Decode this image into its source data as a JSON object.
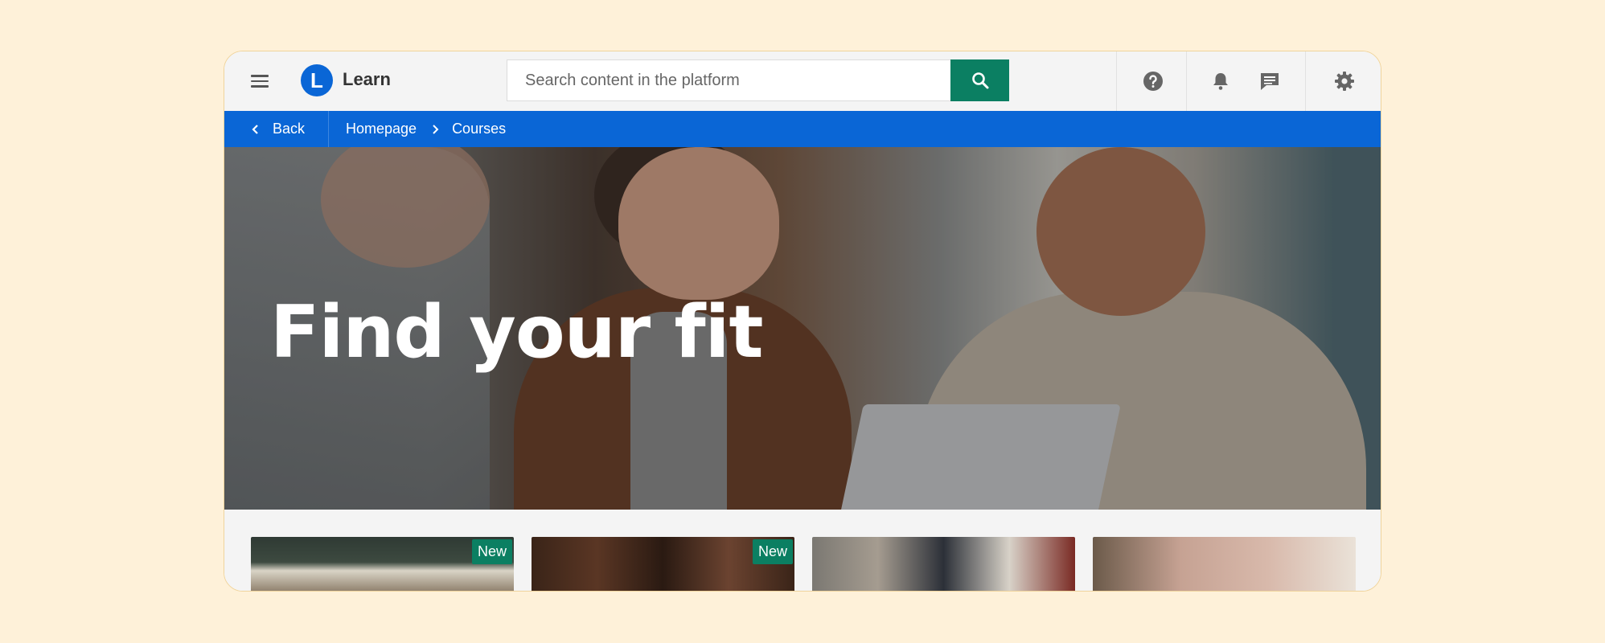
{
  "app": {
    "brand_logo_letter": "L",
    "brand_name": "Learn"
  },
  "search": {
    "placeholder": "Search content in the platform",
    "value": ""
  },
  "breadcrumb": {
    "back_label": "Back",
    "items": [
      "Homepage",
      "Courses"
    ]
  },
  "hero": {
    "title": "Find your fit"
  },
  "cards": [
    {
      "badge": "New"
    },
    {
      "badge": "New"
    },
    {
      "badge": ""
    },
    {
      "badge": ""
    }
  ],
  "colors": {
    "primary_blue": "#0a66d6",
    "search_green": "#0b7f62",
    "badge_green": "#0b7f62",
    "page_background": "#fef1d9"
  },
  "icons": {
    "menu": "hamburger-icon",
    "search": "search-icon",
    "help": "help-icon",
    "notifications": "bell-icon",
    "messages": "chat-icon",
    "settings": "gear-icon",
    "back": "chevron-left-icon",
    "crumb_separator": "chevron-right-icon"
  }
}
